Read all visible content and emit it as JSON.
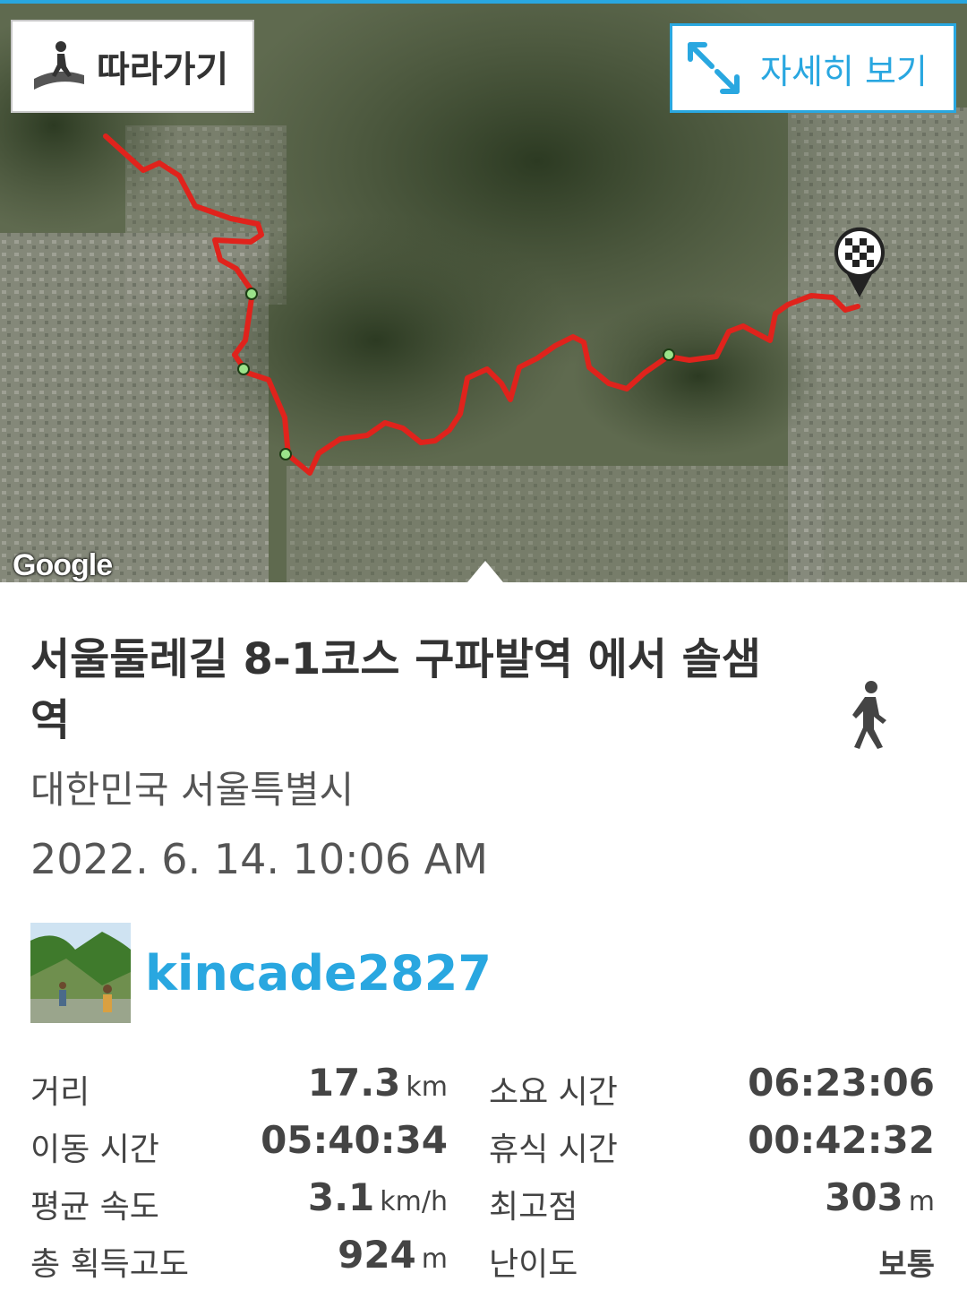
{
  "map": {
    "follow_label": "따라가기",
    "detail_label": "자세히 보기",
    "attribution": "Google"
  },
  "route": {
    "title": "서울둘레길 8-1코스 구파발역 에서 솔샘역",
    "region": "대한민국 서울특별시",
    "datetime": "2022. 6. 14. 10:06 AM",
    "activity_icon": "walking-icon"
  },
  "user": {
    "name": "kincade2827",
    "avatar_icon": "profile-photo"
  },
  "stats": {
    "distance_label": "거리",
    "distance_value": "17.3",
    "distance_unit": "km",
    "duration_label": "소요 시간",
    "duration_value": "06:23:06",
    "moving_label": "이동 시간",
    "moving_value": "05:40:34",
    "rest_label": "휴식 시간",
    "rest_value": "00:42:32",
    "speed_label": "평균 속도",
    "speed_value": "3.1",
    "speed_unit": "km/h",
    "peak_label": "최고점",
    "peak_value": "303",
    "peak_unit": "m",
    "gain_label": "총 획득고도",
    "gain_value": "924",
    "gain_unit": "m",
    "difficulty_label": "난이도",
    "difficulty_value": "보통"
  },
  "colors": {
    "accent": "#29a7e0",
    "route": "#e0231c",
    "text": "#333333"
  }
}
